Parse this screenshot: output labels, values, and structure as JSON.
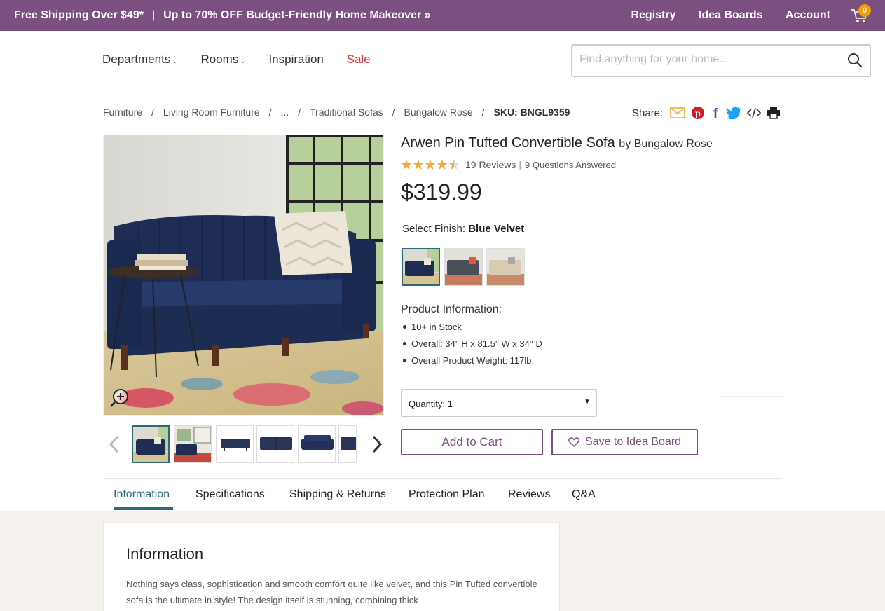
{
  "topbar": {
    "promo_shipping": "Free Shipping Over $49*",
    "promo_separator": "|",
    "promo_sale": "Up to 70% OFF Budget-Friendly Home Makeover »",
    "links": [
      "Registry",
      "Idea Boards",
      "Account"
    ],
    "cart_count": "0",
    "background": "#7b4f80"
  },
  "nav": {
    "departments": "Departments",
    "rooms": "Rooms",
    "inspiration": "Inspiration",
    "sale": "Sale",
    "search_placeholder": "Find anything for your home...",
    "search_icon": "search-icon"
  },
  "breadcrumb": {
    "items": [
      "Furniture",
      "Living Room Furniture",
      "...",
      "Traditional Sofas",
      "Bungalow Rose"
    ],
    "sku": "SKU: BNGL9359"
  },
  "share": {
    "label": "Share:",
    "icons": [
      "email-icon",
      "pinterest-icon",
      "facebook-icon",
      "twitter-icon",
      "embed-icon",
      "print-icon"
    ]
  },
  "product": {
    "title": "Arwen Pin Tufted Convertible Sofa",
    "by_brand": "by Bungalow Rose",
    "rating_stars": 4.5,
    "reviews": "19 Reviews",
    "rating_separator": "|",
    "questions": "9 Questions Answered",
    "price": "$319.99",
    "finish_label": "Select Finish:",
    "finish_value": "Blue Velvet",
    "finish_options": [
      "Blue Velvet",
      "Grey Velvet",
      "Beige"
    ],
    "info_title": "Product Information:",
    "info_items": [
      "10+ in Stock",
      "Overall: 34'' H x 81.5'' W x 34'' D",
      "Overall Product Weight: 117lb."
    ],
    "quantity_label": "Quantity: 1",
    "add_to_cart": "Add to Cart",
    "save_idea": "Save to Idea Board"
  },
  "tabs": [
    "Information",
    "Specifications",
    "Shipping & Returns",
    "Protection Plan",
    "Reviews",
    "Q&A"
  ],
  "info_section": {
    "heading": "Information",
    "body": "Nothing says class, sophistication and smooth comfort quite like velvet, and this Pin Tufted convertible sofa is the ultimate in style! The design itself is stunning, combining thick"
  },
  "colors": {
    "brand": "#7b4f80",
    "accent_teal": "#2c6b75",
    "sale_red": "#d2373c",
    "star": "#f0a93a"
  }
}
